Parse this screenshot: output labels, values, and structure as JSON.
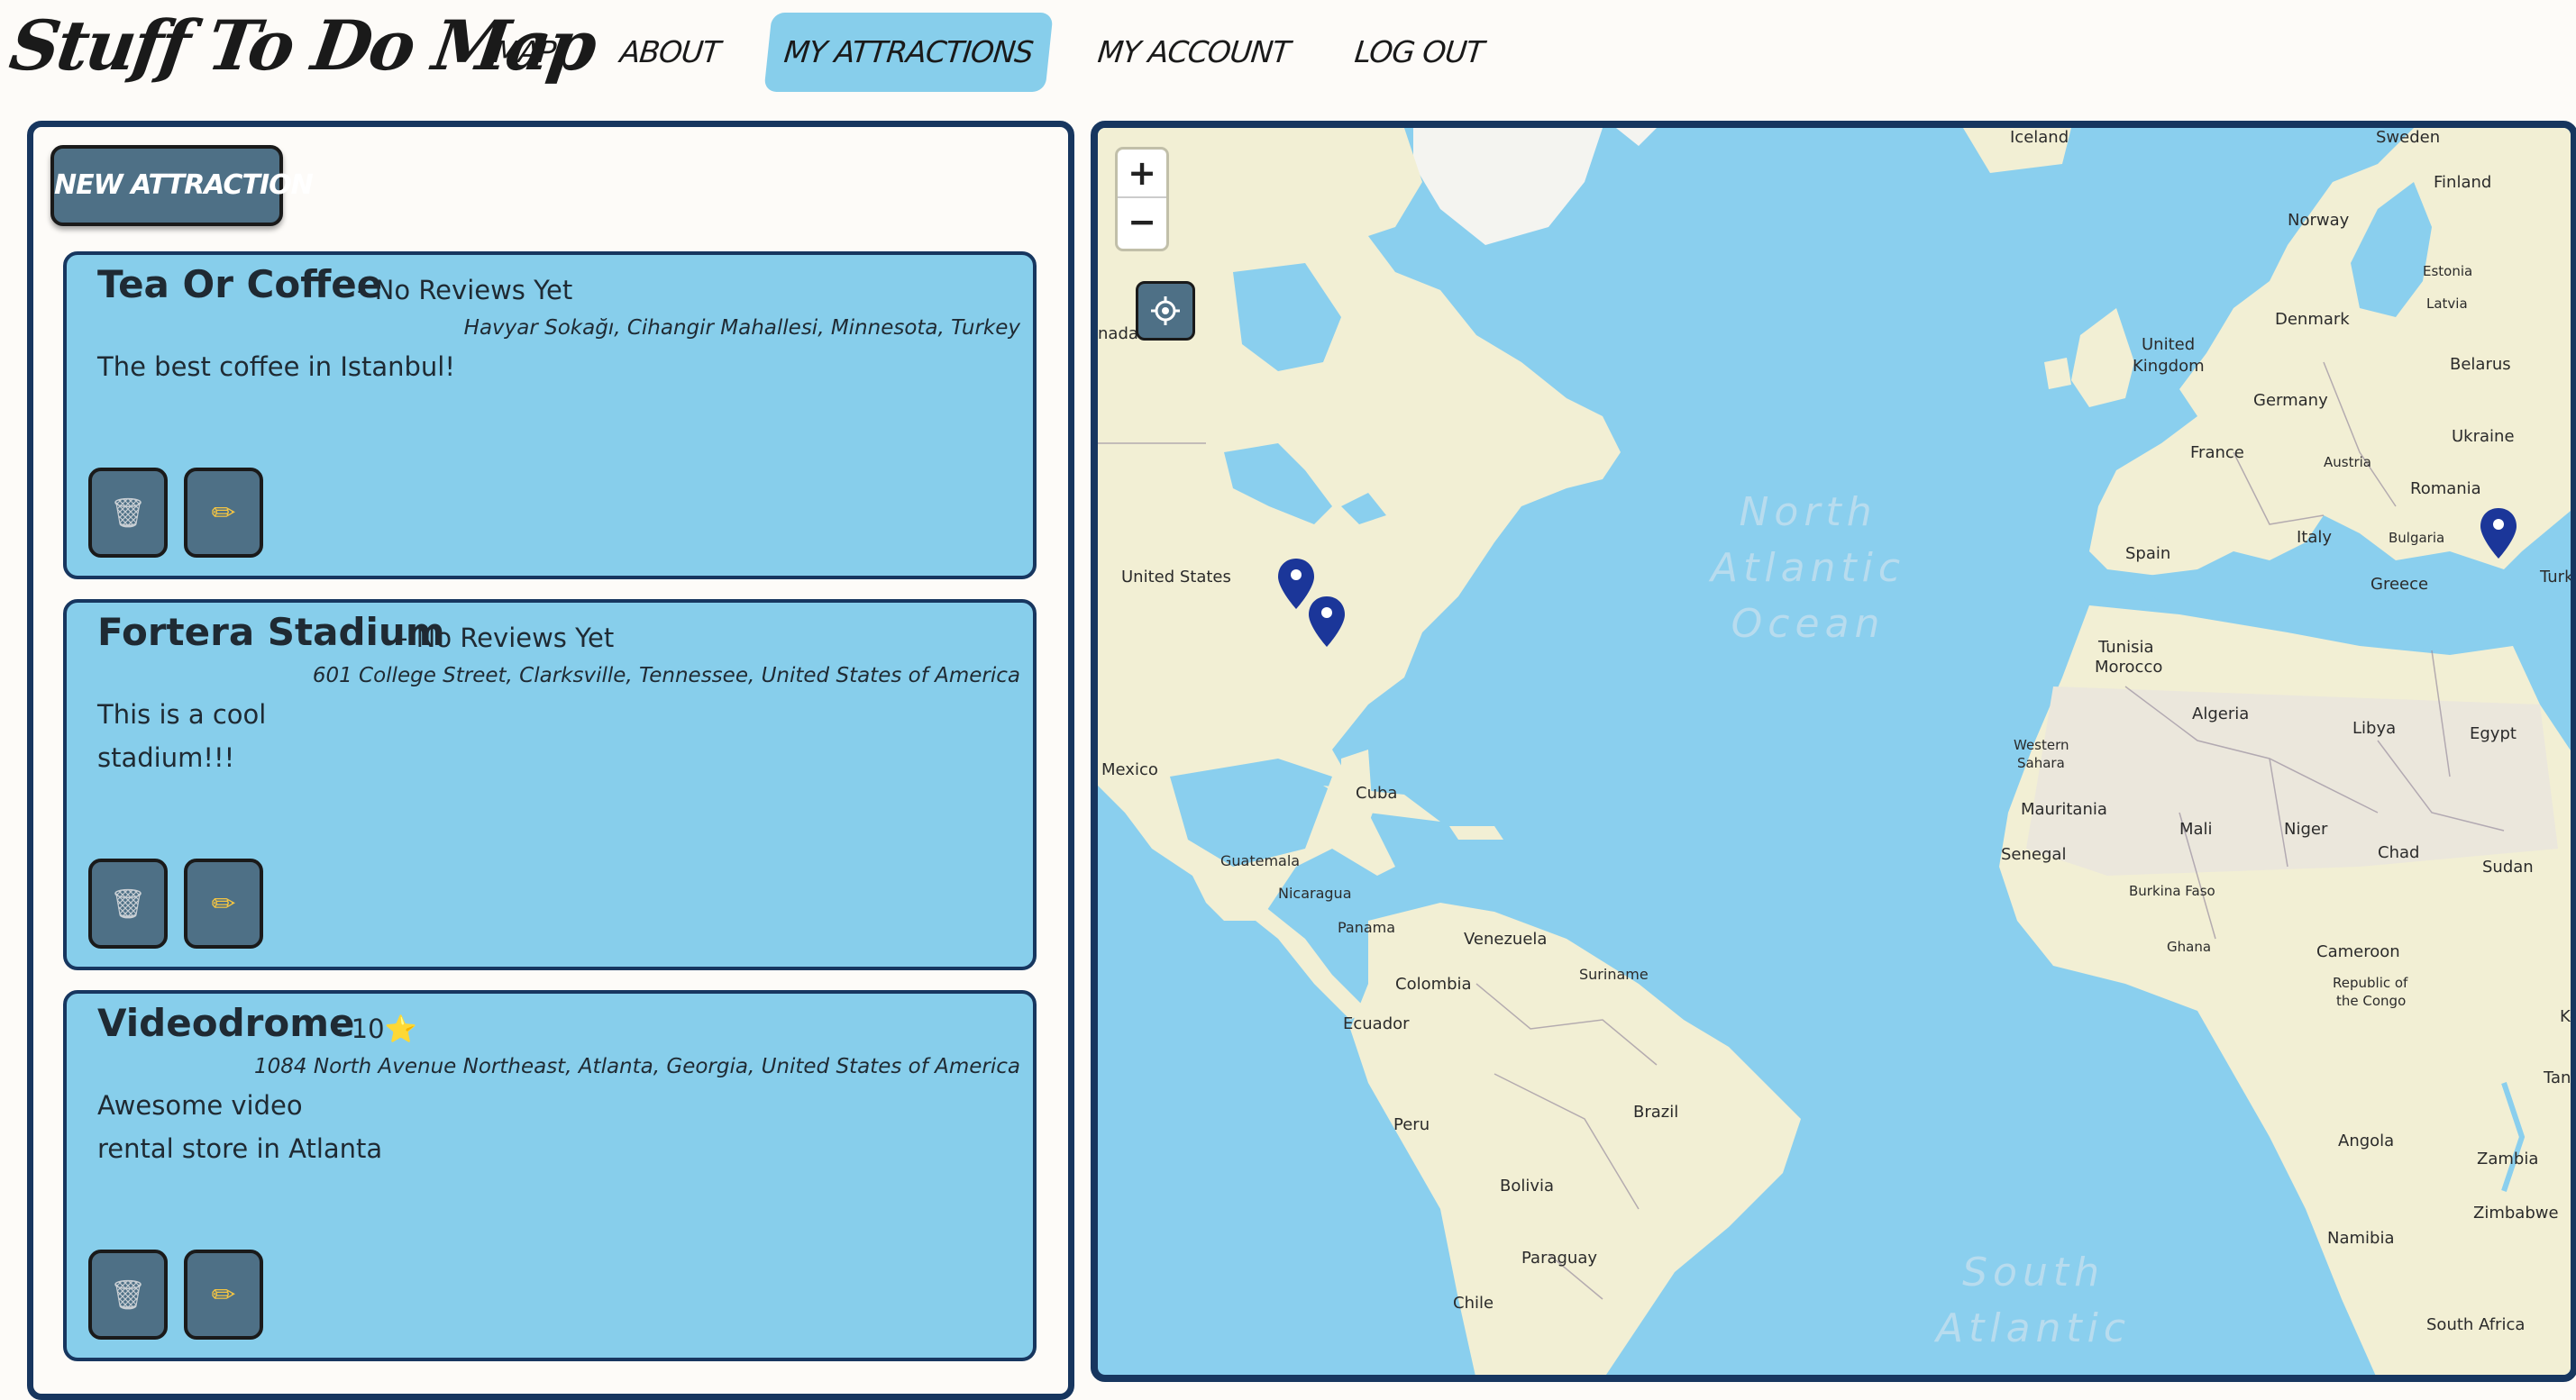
{
  "app": {
    "logo": "Stuff To Do Map"
  },
  "nav": {
    "items": [
      {
        "label": "MAP",
        "active": false
      },
      {
        "label": "ABOUT",
        "active": false
      },
      {
        "label": "MY ATTRACTIONS",
        "active": true
      },
      {
        "label": "MY ACCOUNT",
        "active": false
      },
      {
        "label": "LOG OUT",
        "active": false
      }
    ]
  },
  "sidebar": {
    "new_button_label": "NEW ATTRACTION",
    "cards": [
      {
        "title": "Tea Or Coffee",
        "rating": "- No Reviews Yet",
        "address": "Havyar Sokağı, Cihangir Mahallesi, Minnesota, Turkey",
        "description_lines": [
          "The best coffee in Istanbul!"
        ],
        "trash_icon": "trash-icon",
        "edit_icon": "pencil-icon"
      },
      {
        "title": "Fortera Stadium",
        "rating": "- No Reviews Yet",
        "address": "601 College Street, Clarksville, Tennessee, United States of America",
        "description_lines": [
          "This is a cool",
          "stadium!!!"
        ],
        "trash_icon": "trash-icon",
        "edit_icon": "pencil-icon"
      },
      {
        "title": "Videodrome",
        "rating": "- 10⭐",
        "address": "1084 North Avenue Northeast, Atlanta, Georgia, United States of America",
        "description_lines": [
          "Awesome video",
          "rental store in Atlanta"
        ],
        "trash_icon": "trash-icon",
        "edit_icon": "pencil-icon"
      }
    ]
  },
  "map": {
    "zoom_in": "+",
    "zoom_out": "−",
    "locate_icon": "crosshair-icon",
    "labels": {
      "iceland": "Iceland",
      "sweden": "Sweden",
      "finland": "Finland",
      "norway": "Norway",
      "estonia": "Estonia",
      "latvia": "Latvia",
      "denmark": "Denmark",
      "united_kingdom_1": "United",
      "united_kingdom_2": "Kingdom",
      "belarus": "Belarus",
      "germany": "Germany",
      "ukraine": "Ukraine",
      "france": "France",
      "austria": "Austria",
      "romania": "Romania",
      "spain": "Spain",
      "italy": "Italy",
      "bulgaria": "Bulgaria",
      "greece": "Greece",
      "turkey": "Turk",
      "canada": "nada",
      "united_states": "United States",
      "ocean_north": "North\nAtlantic\nOcean",
      "ocean_south": "South\nAtlantic",
      "tunisia": "Tunisia",
      "morocco": "Morocco",
      "algeria": "Algeria",
      "libya": "Libya",
      "egypt": "Egypt",
      "western_sahara_1": "Western",
      "western_sahara_2": "Sahara",
      "mauritania": "Mauritania",
      "mali": "Mali",
      "niger": "Niger",
      "chad": "Chad",
      "sudan": "Sudan",
      "senegal": "Senegal",
      "burkina_faso": "Burkina Faso",
      "ghana": "Ghana",
      "cameroon": "Cameroon",
      "congo_1": "Republic of",
      "congo_2": "the Congo",
      "mexico": "Mexico",
      "cuba": "Cuba",
      "guatemala": "Guatemala",
      "nicaragua": "Nicaragua",
      "panama": "Panama",
      "venezuela": "Venezuela",
      "suriname": "Suriname",
      "colombia": "Colombia",
      "ecuador": "Ecuador",
      "peru": "Peru",
      "brazil": "Brazil",
      "bolivia": "Bolivia",
      "paraguay": "Paraguay",
      "chile": "Chile",
      "angola": "Angola",
      "zambia": "Zambia",
      "tanzania": "Tanz",
      "zimbabwe": "Zimbabwe",
      "namibia": "Namibia",
      "south_africa": "South Africa",
      "kenya": "Ke"
    },
    "colors": {
      "water": "#8acfee",
      "land": "#f2efd4",
      "desert": "#ebe7dc",
      "marker": "#1b3699"
    }
  }
}
